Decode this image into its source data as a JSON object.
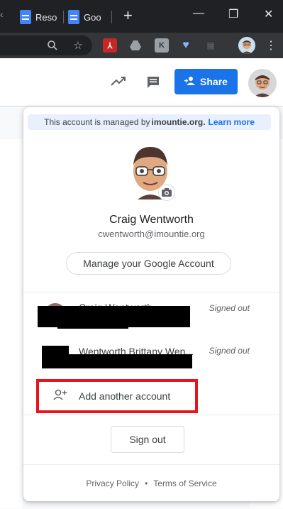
{
  "browser": {
    "tabs": [
      {
        "label": "Reso",
        "icon": "docs-icon"
      },
      {
        "label": "Goo",
        "icon": "docs-icon"
      }
    ],
    "new_tab": "+",
    "window_controls": {
      "minimize": "—",
      "restore": "❐",
      "close": "✕"
    }
  },
  "docs_header": {
    "share_label": "Share"
  },
  "account_popup": {
    "managed_notice": {
      "prefix": "This account is managed by",
      "domain": "imountie.org.",
      "link": "Learn more"
    },
    "name": "Craig Wentworth",
    "email": "cwentworth@imountie.org",
    "manage_label": "Manage your Google Account",
    "other_accounts": [
      {
        "name": "Craig Wentworth",
        "status": "Signed out"
      },
      {
        "name": "Wentworth Brittany Wen...",
        "status": "Signed out"
      }
    ],
    "add_account_label": "Add another account",
    "sign_out_label": "Sign out",
    "footer": {
      "privacy": "Privacy Policy",
      "separator": "•",
      "terms": "Terms of Service"
    }
  },
  "colors": {
    "accent": "#1a73e8",
    "highlight_box": "#e8141c",
    "managed_banner": "#e8f0fe"
  }
}
